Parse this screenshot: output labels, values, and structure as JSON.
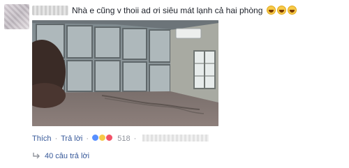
{
  "comment": {
    "text": "Nhà e cũng v thoii ad ơi siêu mát lạnh cả hai phòng",
    "emoji_icons": [
      "laughing-emoji",
      "laughing-emoji",
      "laughing-emoji"
    ]
  },
  "actions": {
    "like_label": "Thích",
    "reply_label": "Trả lời",
    "reaction_count": "518"
  },
  "replies": {
    "label": "40 câu trả lời"
  },
  "colors": {
    "link": "#365899",
    "text": "#1d2129",
    "meta": "#90949c"
  }
}
